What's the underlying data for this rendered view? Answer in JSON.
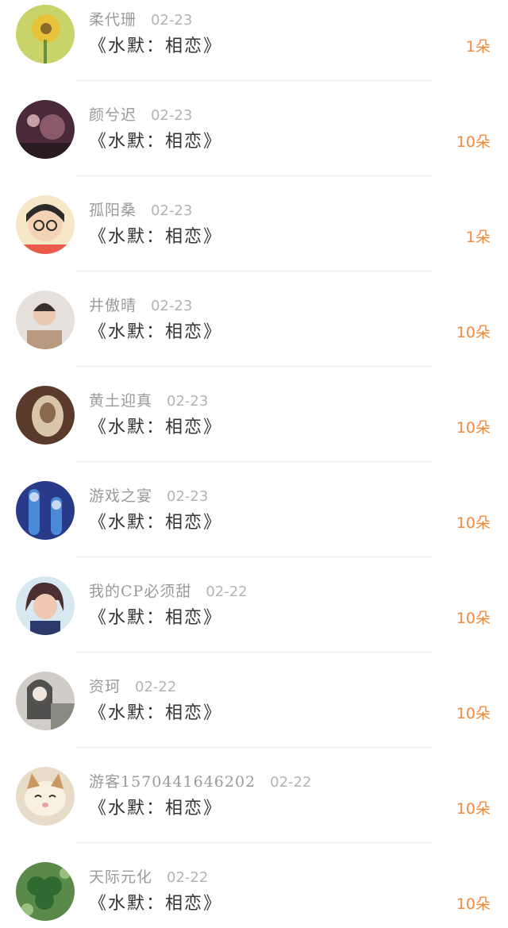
{
  "gift_list": [
    {
      "name": "柔代珊",
      "date": "02-23",
      "title": "《水默：相恋》",
      "count": "1朵",
      "avatar": {
        "colors": [
          "#c8d46a",
          "#e8c23a",
          "#6a8f3a"
        ]
      }
    },
    {
      "name": "颜兮迟",
      "date": "02-23",
      "title": "《水默：相恋》",
      "count": "10朵",
      "avatar": {
        "colors": [
          "#4a2a3a",
          "#8a5a6a",
          "#c9a0a8"
        ]
      }
    },
    {
      "name": "孤阳桑",
      "date": "02-23",
      "title": "《水默：相恋》",
      "count": "1朵",
      "avatar": {
        "colors": [
          "#f6e7c6",
          "#2b2b2b",
          "#e85a4a"
        ]
      }
    },
    {
      "name": "井傲晴",
      "date": "02-23",
      "title": "《水默：相恋》",
      "count": "10朵",
      "avatar": {
        "colors": [
          "#e6e1dc",
          "#3a302a",
          "#b89a80"
        ]
      }
    },
    {
      "name": "黄土迎真",
      "date": "02-23",
      "title": "《水默：相恋》",
      "count": "10朵",
      "avatar": {
        "colors": [
          "#5a3a2a",
          "#d9c5a8",
          "#8a6a4a"
        ]
      }
    },
    {
      "name": "游戏之宴",
      "date": "02-23",
      "title": "《水默：相恋》",
      "count": "10朵",
      "avatar": {
        "colors": [
          "#2a3a8a",
          "#4a8ad8",
          "#c8d8f0"
        ]
      }
    },
    {
      "name": "我的CP必须甜",
      "date": "02-22",
      "title": "《水默：相恋》",
      "count": "10朵",
      "avatar": {
        "colors": [
          "#d8e8f0",
          "#4a3030",
          "#f0c8b0"
        ]
      }
    },
    {
      "name": "资珂",
      "date": "02-22",
      "title": "《水默：相恋》",
      "count": "10朵",
      "avatar": {
        "colors": [
          "#d0ccc8",
          "#3a3a3a",
          "#8a8a80"
        ]
      }
    },
    {
      "name": "游客1570441646202",
      "date": "02-22",
      "title": "《水默：相恋》",
      "count": "10朵",
      "avatar": {
        "colors": [
          "#e8dcc8",
          "#c89a60",
          "#f8f0e0"
        ]
      }
    },
    {
      "name": "天际元化",
      "date": "02-22",
      "title": "《水默：相恋》",
      "count": "10朵",
      "avatar": {
        "colors": [
          "#5a8a4a",
          "#2f6a30",
          "#9ac080"
        ]
      }
    }
  ]
}
